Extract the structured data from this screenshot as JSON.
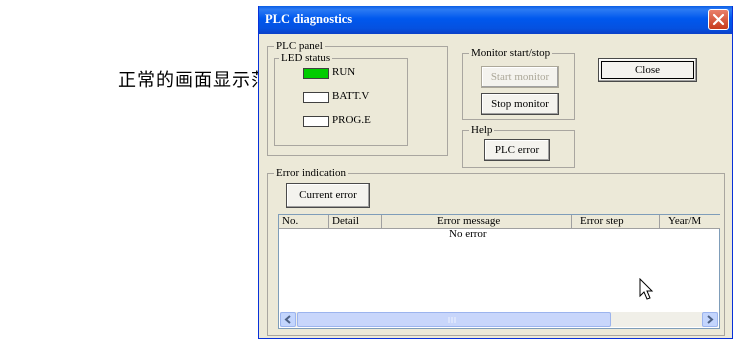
{
  "caption": "正常的画面显示范例：",
  "window": {
    "title": "PLC diagnostics",
    "close_icon": "close-x-icon"
  },
  "plc_panel": {
    "legend": "PLC panel",
    "led_status": {
      "legend": "LED status",
      "leds": [
        {
          "label": "RUN",
          "color": "#00cc00"
        },
        {
          "label": "BATT.V",
          "color": "#ffffff"
        },
        {
          "label": "PROG.E",
          "color": "#ffffff"
        }
      ]
    }
  },
  "monitor": {
    "legend": "Monitor start/stop",
    "start_label": "Start monitor",
    "stop_label": "Stop monitor"
  },
  "close_label": "Close",
  "help": {
    "legend": "Help",
    "plc_error_label": "PLC error"
  },
  "error_indication": {
    "legend": "Error indication",
    "current_error_label": "Current error",
    "columns": [
      "No.",
      "Detail",
      "Error message",
      "Error step",
      "Year/M"
    ],
    "empty_message": "No error"
  }
}
